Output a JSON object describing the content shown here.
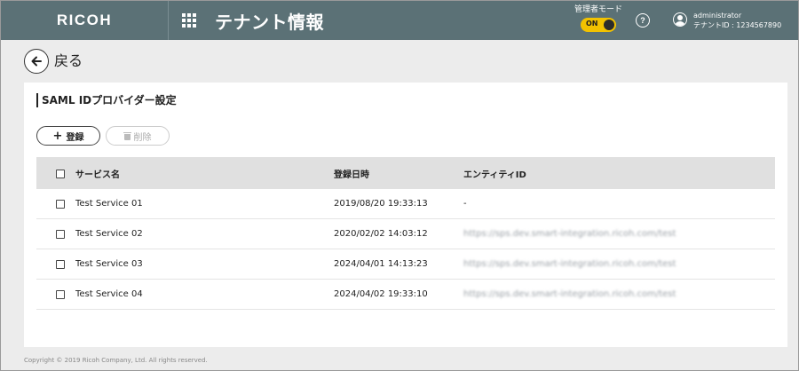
{
  "header": {
    "logo": "RICOH",
    "title": "テナント情報",
    "admin_mode_label": "管理者モード",
    "admin_mode_toggle": "ON",
    "user_name": "administrator",
    "tenant_id": "テナントID : 1234567890"
  },
  "nav": {
    "back_label": "戻る"
  },
  "panel": {
    "title": "SAML IDプロバイダー設定",
    "register_label": "登録",
    "delete_label": "削除"
  },
  "table": {
    "headers": {
      "name": "サービス名",
      "date": "登録日時",
      "entity": "エンティティID"
    },
    "rows": [
      {
        "name": "Test Service 01",
        "date": "2019/08/20 19:33:13",
        "entity": "-"
      },
      {
        "name": "Test Service 02",
        "date": "2020/02/02 14:03:12",
        "entity": "https://sps.dev.smart-integration.ricoh.com/test"
      },
      {
        "name": "Test Service 03",
        "date": "2024/04/01 14:13:23",
        "entity": "https://sps.dev.smart-integration.ricoh.com/test"
      },
      {
        "name": "Test Service 04",
        "date": "2024/04/02 19:33:10",
        "entity": "https://sps.dev.smart-integration.ricoh.com/test"
      }
    ]
  },
  "footer": {
    "copyright": "Copyright © 2019 Ricoh Company, Ltd. All rights reserved."
  },
  "colors": {
    "header_bg": "#5b7176",
    "toggle_on": "#f2c200",
    "table_header_bg": "#e0e0e0"
  },
  "icons": [
    "apps-grid-icon",
    "help-icon",
    "user-icon",
    "back-arrow-icon",
    "plus-icon",
    "trash-icon"
  ]
}
